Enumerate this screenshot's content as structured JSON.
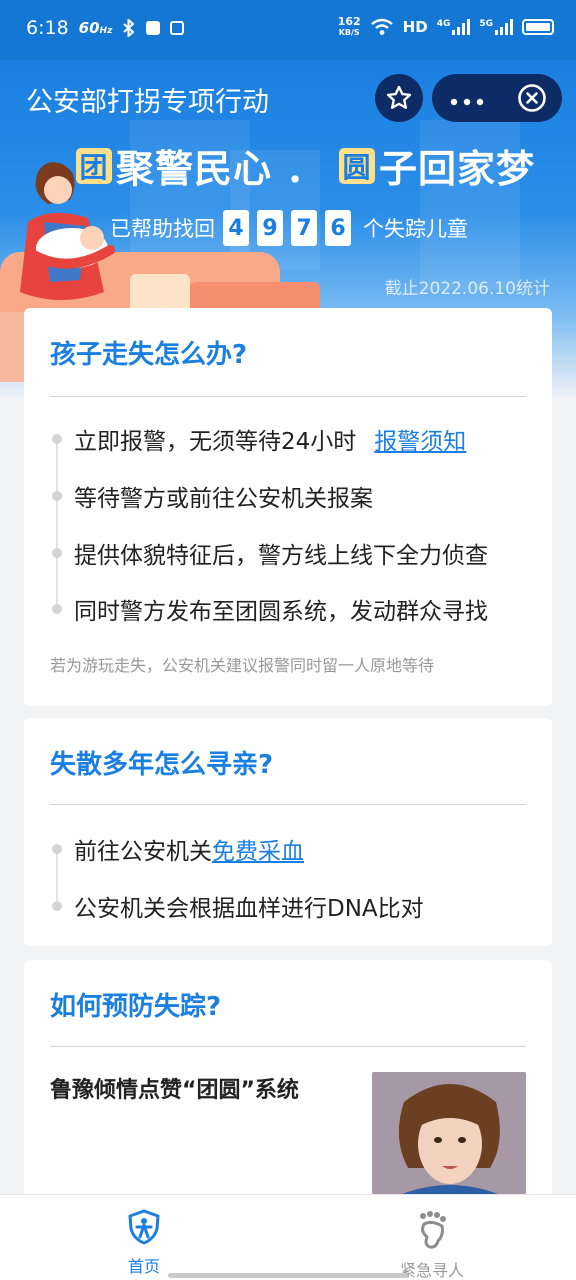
{
  "status_bar": {
    "time": "6:18",
    "refresh": "60",
    "refresh_unit": "Hz",
    "net_speed_value": "162",
    "net_speed_unit": "KB/S",
    "hd": "HD",
    "sim1": "4G",
    "sim2": "5G"
  },
  "header": {
    "title": "公安部打拐专项行动",
    "slogan": {
      "p1_highlight": "团",
      "p1_rest": "聚警民心",
      "separator": "．",
      "p2_highlight": "圆",
      "p2_rest": "子回家梦"
    },
    "found_prefix": "已帮助找回",
    "found_digits": [
      "4",
      "9",
      "7",
      "6"
    ],
    "found_suffix": "个失踪儿童",
    "stat_date": "截止2022.06.10统计"
  },
  "cards": [
    {
      "title": "孩子走失怎么办?",
      "steps": [
        {
          "text": "立即报警，无须等待24小时",
          "link": "报警须知"
        },
        {
          "text": "等待警方或前往公安机关报案"
        },
        {
          "text": "提供体貌特征后，警方线上线下全力侦查"
        },
        {
          "text": "同时警方发布至团圆系统，发动群众寻找"
        }
      ],
      "hint": "若为游玩走失，公安机关建议报警同时留一人原地等待"
    },
    {
      "title": "失散多年怎么寻亲?",
      "steps": [
        {
          "text": "前往公安机关",
          "link": "免费采血"
        },
        {
          "text": "公安机关会根据血样进行DNA比对"
        }
      ]
    },
    {
      "title": "如何预防失踪?",
      "news_title": "鲁豫倾情点赞“团圆”系统"
    }
  ],
  "tabs": [
    {
      "label": "首页",
      "icon": "shield-person-icon",
      "active": true
    },
    {
      "label": "紧急寻人",
      "icon": "footprint-icon",
      "active": false
    }
  ],
  "colors": {
    "brand": "#1a7fe0",
    "capsule": "#0d2c66",
    "highlight": "#ffe08a",
    "inactive": "#999999"
  }
}
